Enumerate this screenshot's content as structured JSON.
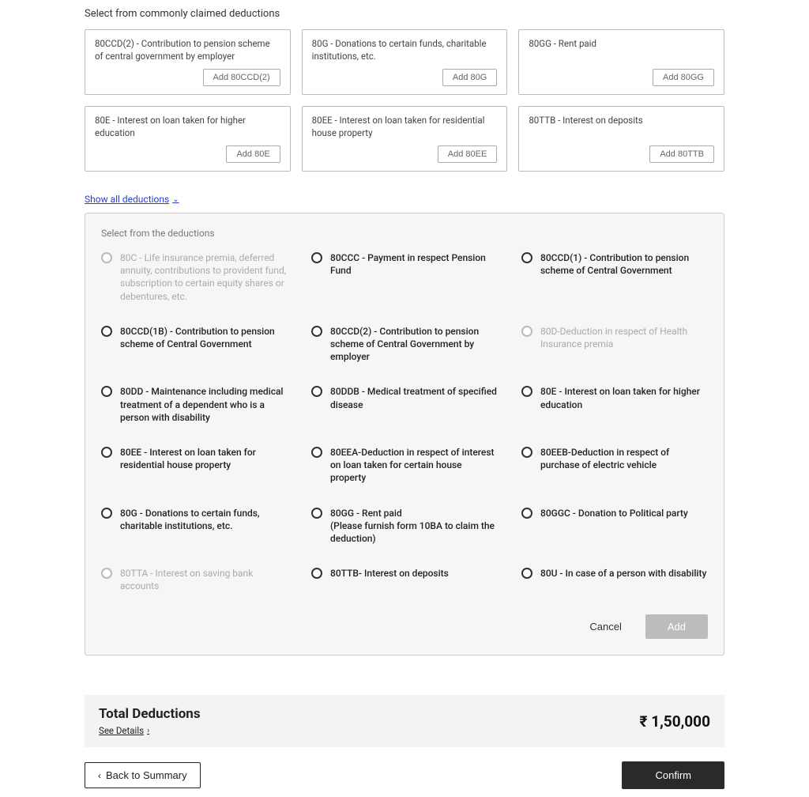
{
  "section_title": "Select from commonly claimed deductions",
  "cards": [
    {
      "title": "80CCD(2) - Contribution to pension scheme of central government by employer",
      "button": "Add 80CCD(2)"
    },
    {
      "title": "80G - Donations to certain funds, charitable institutions, etc.",
      "button": "Add 80G"
    },
    {
      "title": "80GG - Rent paid",
      "button": "Add 80GG"
    },
    {
      "title": "80E - Interest on loan taken for higher education",
      "button": "Add 80E"
    },
    {
      "title": "80EE - Interest on loan taken for residential house property",
      "button": "Add 80EE"
    },
    {
      "title": "80TTB - Interest on deposits",
      "button": "Add 80TTB"
    }
  ],
  "show_all_label": "Show all deductions",
  "panel_title": "Select from the deductions",
  "options": [
    {
      "label": "80C - Life insurance premia, deferred annuity, contributions to provident fund, subscription to certain equity shares or debentures, etc.",
      "disabled": true
    },
    {
      "label": "80CCC - Payment in respect Pension Fund",
      "disabled": false
    },
    {
      "label": "80CCD(1) - Contribution to pension scheme of Central Government",
      "disabled": false
    },
    {
      "label": "80CCD(1B) - Contribution to pension scheme of Central Government",
      "disabled": false
    },
    {
      "label": "80CCD(2) - Contribution to pension scheme of Central Government by employer",
      "disabled": false
    },
    {
      "label": "80D-Deduction in respect of Health Insurance premia",
      "disabled": true
    },
    {
      "label": "80DD - Maintenance including medical treatment of a dependent who is a person with disability",
      "disabled": false
    },
    {
      "label": "80DDB - Medical treatment of specified disease",
      "disabled": false
    },
    {
      "label": "80E - Interest on loan taken for higher education",
      "disabled": false
    },
    {
      "label": "80EE - Interest on loan taken for residential house property",
      "disabled": false
    },
    {
      "label": "80EEA-Deduction in respect of interest on loan taken for certain house property",
      "disabled": false
    },
    {
      "label": "80EEB-Deduction in respect of purchase of electric vehicle",
      "disabled": false
    },
    {
      "label": "80G - Donations to certain funds, charitable institutions, etc.",
      "disabled": false
    },
    {
      "label": "80GG - Rent paid\n(Please furnish form 10BA to claim the deduction)",
      "disabled": false
    },
    {
      "label": "80GGC - Donation to Political party",
      "disabled": false
    },
    {
      "label": "80TTA - Interest on saving bank accounts",
      "disabled": true
    },
    {
      "label": "80TTB- Interest on deposits",
      "disabled": false
    },
    {
      "label": "80U - In case of a person with disability",
      "disabled": false
    }
  ],
  "panel_actions": {
    "cancel": "Cancel",
    "add": "Add"
  },
  "summary": {
    "title": "Total Deductions",
    "see_details": "See Details",
    "amount": "₹ 1,50,000"
  },
  "footer": {
    "back": "Back to Summary",
    "confirm": "Confirm"
  }
}
